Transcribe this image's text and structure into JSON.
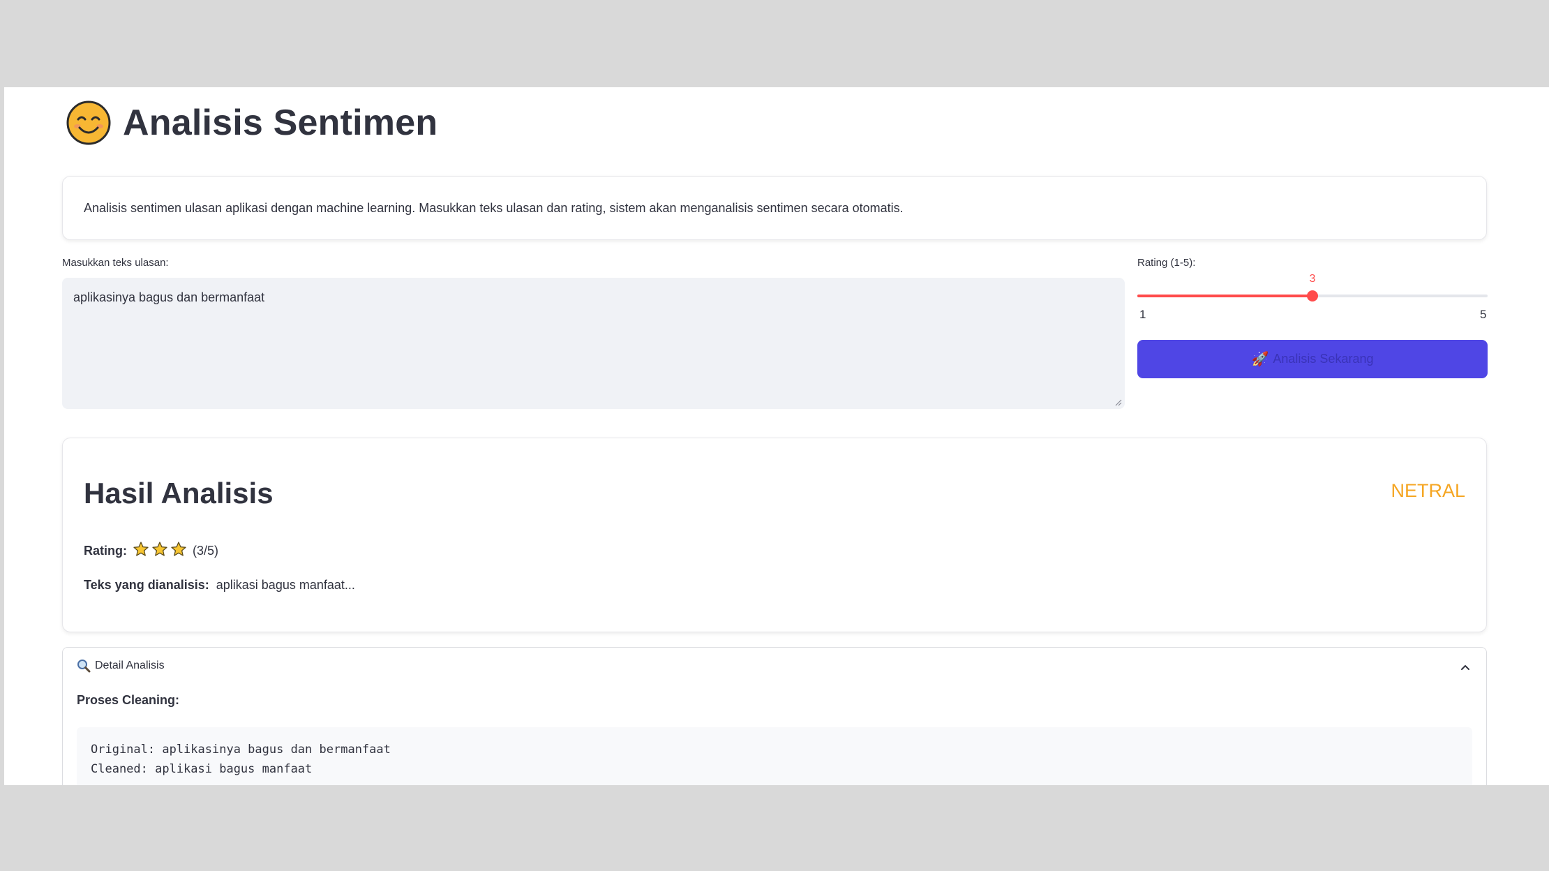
{
  "header": {
    "title": "Analisis Sentimen",
    "icon": "smiling-face-icon"
  },
  "info": {
    "text": "Analisis sentimen ulasan aplikasi dengan machine learning. Masukkan teks ulasan dan rating, sistem akan menganalisis sentimen secara otomatis."
  },
  "review_input": {
    "label": "Masukkan teks ulasan:",
    "value": "aplikasinya bagus dan bermanfaat"
  },
  "rating_slider": {
    "label": "Rating (1-5):",
    "value": 3,
    "value_text": "3",
    "min": 1,
    "max": 5,
    "min_label": "1",
    "max_label": "5",
    "accent_color": "#ff4b4b"
  },
  "analyze_button": {
    "label": "Analisis Sekarang",
    "icon": "rocket-icon",
    "color": "#4f46e5"
  },
  "result": {
    "title": "Hasil Analisis",
    "sentiment": "NETRAL",
    "sentiment_color": "#f5a623",
    "rating_label": "Rating:",
    "stars": 3,
    "rating_count": "(3/5)",
    "analyzed_label": "Teks yang dianalisis:",
    "analyzed_text": "aplikasi bagus manfaat..."
  },
  "detail": {
    "header": "Detail Analisis",
    "icon": "magnifier-icon",
    "expanded": true,
    "cleaning_title": "Proses Cleaning:",
    "original_line": "Original: aplikasinya bagus dan bermanfaat",
    "cleaned_line": "Cleaned: aplikasi bagus manfaat"
  }
}
